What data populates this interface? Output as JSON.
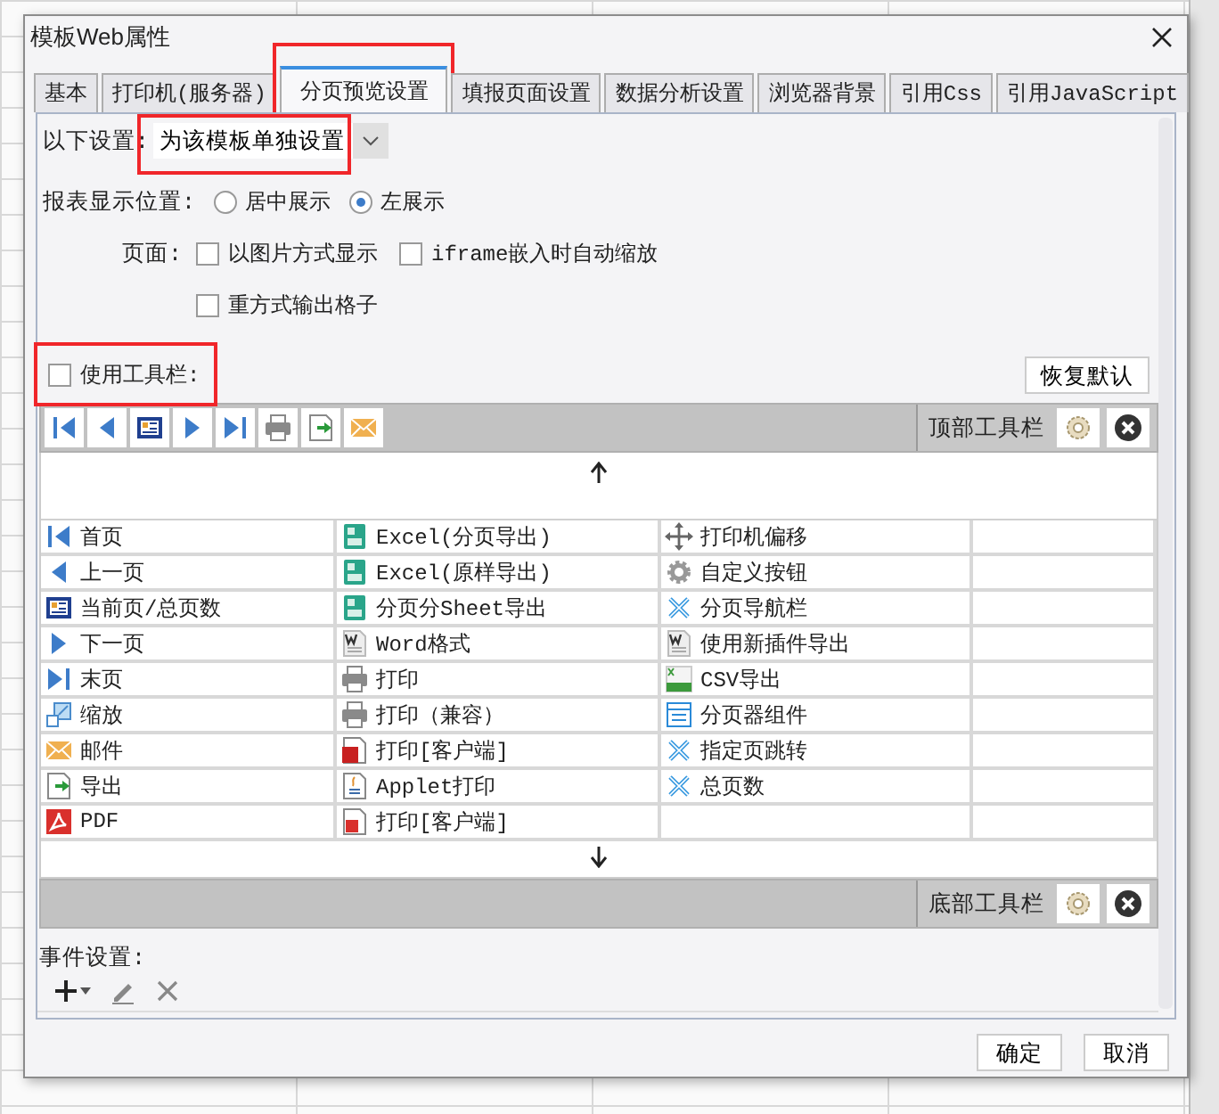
{
  "window": {
    "title": "模板Web属性"
  },
  "tabs": [
    {
      "label": "基本",
      "selected": false,
      "highlighted": false
    },
    {
      "label": "打印机(服务器)",
      "selected": false,
      "highlighted": false
    },
    {
      "label": "分页预览设置",
      "selected": true,
      "highlighted": true
    },
    {
      "label": "填报页面设置",
      "selected": false,
      "highlighted": false
    },
    {
      "label": "数据分析设置",
      "selected": false,
      "highlighted": false
    },
    {
      "label": "浏览器背景",
      "selected": false,
      "highlighted": false
    },
    {
      "label": "引用Css",
      "selected": false,
      "highlighted": false
    },
    {
      "label": "引用JavaScript",
      "selected": false,
      "highlighted": false
    }
  ],
  "scope": {
    "label": "以下设置:",
    "value": "为该模板单独设置",
    "highlighted": true
  },
  "position": {
    "label": "报表显示位置:",
    "options": [
      {
        "label": "居中展示",
        "selected": false
      },
      {
        "label": "左展示",
        "selected": true
      }
    ]
  },
  "page": {
    "label": "页面:",
    "options": [
      {
        "label": "以图片方式显示",
        "checked": false
      },
      {
        "label": "iframe嵌入时自动缩放",
        "checked": false
      },
      {
        "label": "重方式输出格子",
        "checked": false
      }
    ]
  },
  "use_toolbar": {
    "label": "使用工具栏:",
    "checked": false,
    "highlighted": true
  },
  "restore_button": "恢复默认",
  "top_toolbar": {
    "buttons": [
      {
        "kind": "first"
      },
      {
        "kind": "prev"
      },
      {
        "kind": "pageinfo"
      },
      {
        "kind": "next"
      },
      {
        "kind": "last"
      },
      {
        "kind": "print"
      },
      {
        "kind": "export"
      },
      {
        "kind": "email"
      }
    ],
    "label": "顶部工具栏"
  },
  "item_columns": [
    [
      {
        "label": "首页",
        "kind": "first"
      },
      {
        "label": "上一页",
        "kind": "prev"
      },
      {
        "label": "当前页/总页数",
        "kind": "pageinfo"
      },
      {
        "label": "下一页",
        "kind": "next"
      },
      {
        "label": "末页",
        "kind": "last"
      },
      {
        "label": "缩放",
        "kind": "zoom"
      },
      {
        "label": "邮件",
        "kind": "email"
      },
      {
        "label": "导出",
        "kind": "export"
      },
      {
        "label": "PDF",
        "kind": "pdf"
      }
    ],
    [
      {
        "label": "Excel(分页导出)",
        "kind": "excel"
      },
      {
        "label": "Excel(原样导出)",
        "kind": "excel"
      },
      {
        "label": "分页分Sheet导出",
        "kind": "excel"
      },
      {
        "label": "Word格式",
        "kind": "word"
      },
      {
        "label": "打印",
        "kind": "print"
      },
      {
        "label": "打印（兼容）",
        "kind": "print"
      },
      {
        "label": "打印[客户端]",
        "kind": "flash"
      },
      {
        "label": "Applet打印",
        "kind": "applet"
      },
      {
        "label": "打印[客户端]",
        "kind": "pdfdoc"
      }
    ],
    [
      {
        "label": "打印机偏移",
        "kind": "move"
      },
      {
        "label": "自定义按钮",
        "kind": "gear"
      },
      {
        "label": "分页导航栏",
        "kind": "tools"
      },
      {
        "label": "使用新插件导出",
        "kind": "word"
      },
      {
        "label": "CSV导出",
        "kind": "csv"
      },
      {
        "label": "分页器组件",
        "kind": "window"
      },
      {
        "label": "指定页跳转",
        "kind": "tools"
      },
      {
        "label": "总页数",
        "kind": "tools"
      }
    ]
  ],
  "bottom_toolbar": {
    "label": "底部工具栏"
  },
  "events": {
    "label": "事件设置:"
  },
  "buttons": [
    "确定",
    "取消"
  ]
}
